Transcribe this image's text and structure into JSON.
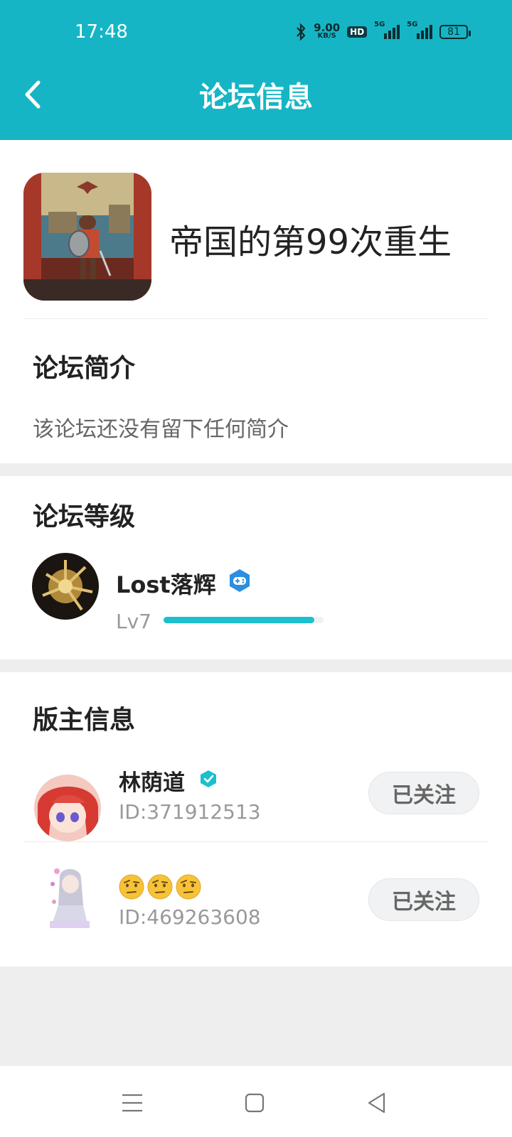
{
  "status_bar": {
    "time": "17:48",
    "net_speed": "9.00",
    "net_unit": "KB/S",
    "hd_label": "HD",
    "signal1_label": "5G",
    "signal2_label": "5G",
    "battery": "81"
  },
  "header": {
    "title": "论坛信息"
  },
  "forum": {
    "name": "帝国的第99次重生"
  },
  "intro": {
    "title": "论坛简介",
    "text": "该论坛还没有留下任何简介"
  },
  "level": {
    "title": "论坛等级",
    "user_name": "Lost落辉",
    "level_label": "Lv7",
    "progress": 0.94
  },
  "moderators": {
    "title": "版主信息",
    "list": [
      {
        "name": "林荫道",
        "id": "ID:371912513",
        "button": "已关注",
        "verified": true
      },
      {
        "name": "",
        "emoji_count": 3,
        "id": "ID:469263608",
        "button": "已关注",
        "verified": false
      }
    ]
  },
  "colors": {
    "accent": "#16b5c5",
    "progress": "#1cbfcd"
  }
}
